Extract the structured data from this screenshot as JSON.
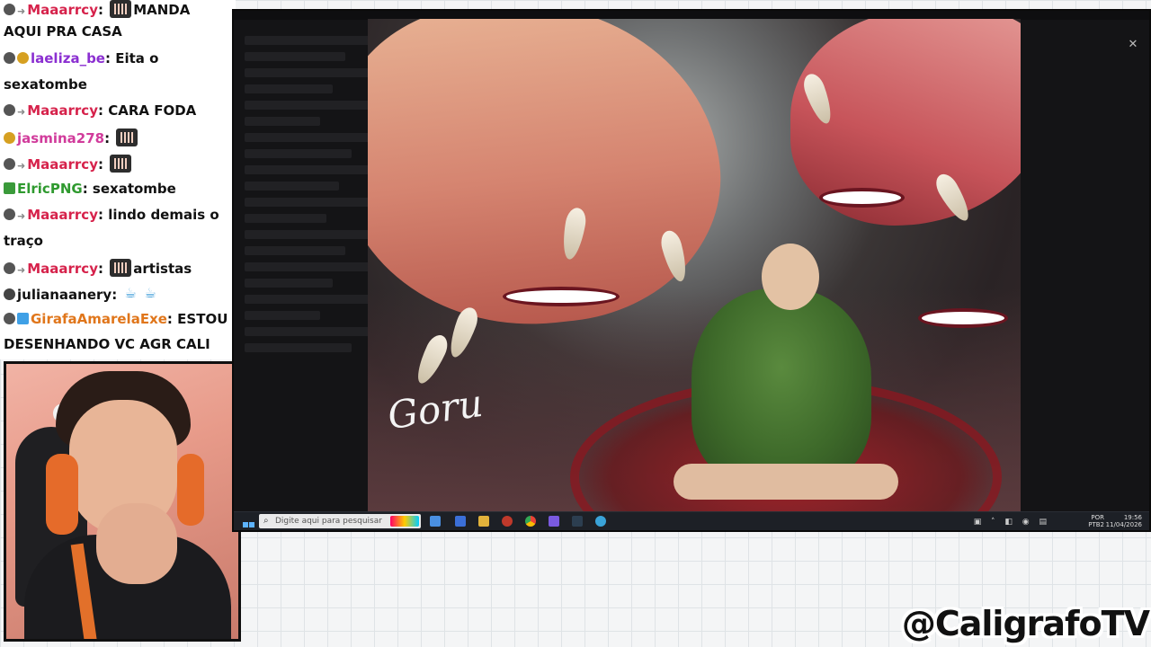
{
  "chat": {
    "messages": [
      {
        "user": "Maaarrcy",
        "sep": ":",
        "text": "MANDA",
        "emote": true
      },
      {
        "user": "",
        "sep": "",
        "text": "AQUI PRA CASA"
      },
      {
        "user": "laeliza_be",
        "sep": ":",
        "text": "Eita o"
      },
      {
        "user": "",
        "sep": "",
        "text": "sexatombe"
      },
      {
        "user": "Maaarrcy",
        "sep": ":",
        "text": "CARA FODA"
      },
      {
        "user": "jasmina278",
        "sep": ":",
        "text": "",
        "emote": true
      },
      {
        "user": "Maaarrcy",
        "sep": ":",
        "text": "",
        "emote": true
      },
      {
        "user": "ElricPNG",
        "sep": ":",
        "text": "sexatombe"
      },
      {
        "user": "Maaarrcy",
        "sep": ":",
        "text": "lindo demais o"
      },
      {
        "user": "",
        "sep": "",
        "text": "traço"
      },
      {
        "user": "Maaarrcy",
        "sep": ":",
        "text": "artistas",
        "emote": true
      },
      {
        "user": "julianaanery",
        "sep": ":",
        "text": ""
      },
      {
        "user": "GirafaAmarelaExe",
        "sep": ":",
        "text": "ESTOU"
      },
      {
        "user": "",
        "sep": "",
        "text": "DESENHANDO VC AGR CALI"
      }
    ]
  },
  "taskbar": {
    "search_placeholder": "Digite aqui para pesquisar",
    "lang_top": "POR",
    "lang_bottom": "PTB2",
    "time": "19:56",
    "date": "11/04/2026"
  },
  "artwork": {
    "signature": "Goru"
  },
  "channel_handle": "@CaligrafoTV",
  "colors": {
    "user_red": "#d6224b",
    "user_pink": "#d13b9b",
    "user_green": "#2f9a2f",
    "user_orange": "#e0761b"
  }
}
